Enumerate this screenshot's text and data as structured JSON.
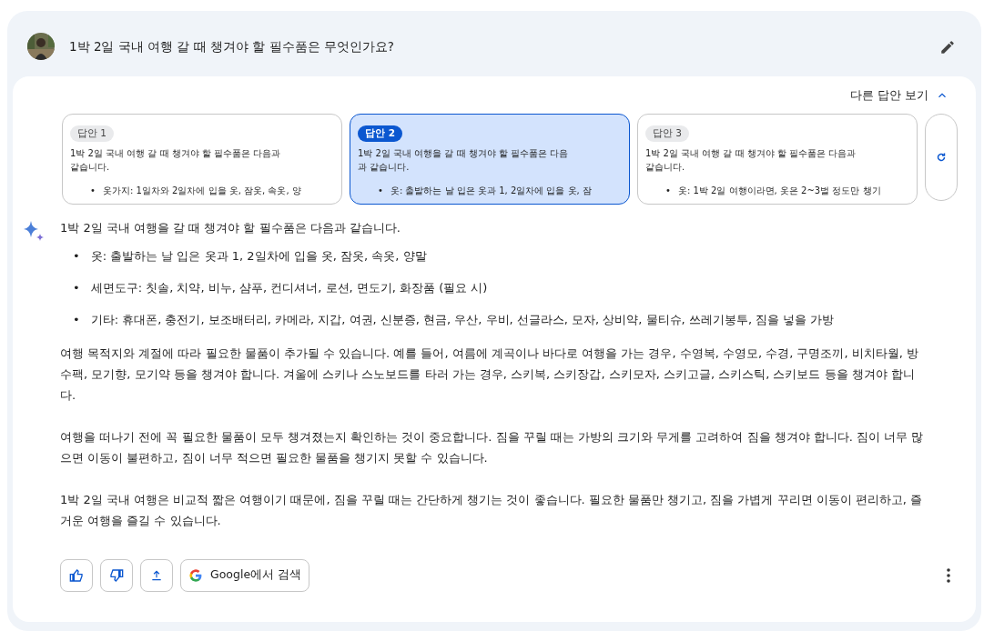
{
  "question": {
    "text": "1박 2일 국내 여행 갈 때 챙겨야 할 필수품은 무엇인가요?"
  },
  "drafts_toggle": {
    "label": "다른 답안 보기",
    "expanded": true
  },
  "drafts": [
    {
      "label": "답안 1",
      "text": "1박 2일 국내 여행 갈 때 챙겨야 할 필수품은 다음과 같습니다.",
      "marker": "•",
      "bullet": "옷가지: 1일차와 2일차에 입을 옷, 잠옷, 속옷, 양",
      "selected": false
    },
    {
      "label": "답안 2",
      "text": "1박 2일 국내 여행을 갈 때 챙겨야 할 필수품은 다음과 같습니다.",
      "marker": "•",
      "bullet": "옷: 출발하는 날 입은 옷과 1, 2일차에 입을 옷, 잠",
      "selected": true
    },
    {
      "label": "답안 3",
      "text": "1박 2일 국내 여행 갈 때 챙겨야 할 필수품은 다음과 같습니다.",
      "marker": "•",
      "bullet": "옷: 1박 2일 여행이라면, 옷은 2~3벌 정도만 챙기",
      "selected": false
    }
  ],
  "answer": {
    "intro": "1박 2일 국내 여행을 갈 때 챙겨야 할 필수품은 다음과 같습니다.",
    "bullets": [
      {
        "marker": "•",
        "text": "옷: 출발하는 날 입은 옷과 1, 2일차에 입을 옷, 잠옷, 속옷, 양말"
      },
      {
        "marker": "•",
        "text": "세면도구: 칫솔, 치약, 비누, 샴푸, 컨디셔너, 로션, 면도기, 화장품 (필요 시)"
      },
      {
        "marker": "•",
        "text": "기타: 휴대폰, 충전기, 보조배터리, 카메라, 지갑, 여권, 신분증, 현금, 우산, 우비, 선글라스, 모자, 상비약, 물티슈, 쓰레기봉투, 짐을 넣을 가방"
      }
    ],
    "paragraphs": [
      "여행 목적지와 계절에 따라 필요한 물품이 추가될 수 있습니다. 예를 들어, 여름에 계곡이나 바다로 여행을 가는 경우, 수영복, 수영모, 수경, 구명조끼, 비치타월, 방수팩, 모기향, 모기약 등을 챙겨야 합니다. 겨울에 스키나 스노보드를 타러 가는 경우, 스키복, 스키장갑, 스키모자, 스키고글, 스키스틱, 스키보드 등을 챙겨야 합니다.",
      "여행을 떠나기 전에 꼭 필요한 물품이 모두 챙겨졌는지 확인하는 것이 중요합니다. 짐을 꾸릴 때는 가방의 크기와 무게를 고려하여 짐을 챙겨야 합니다. 짐이 너무 많으면 이동이 불편하고, 짐이 너무 적으면 필요한 물품을 챙기지 못할 수 있습니다.",
      "1박 2일 국내 여행은 비교적 짧은 여행이기 때문에, 짐을 꾸릴 때는 간단하게 챙기는 것이 좋습니다. 필요한 물품만 챙기고, 짐을 가볍게 꾸리면 이동이 편리하고, 즐거운 여행을 즐길 수 있습니다."
    ]
  },
  "actions": {
    "search_label": "Google에서 검색"
  }
}
